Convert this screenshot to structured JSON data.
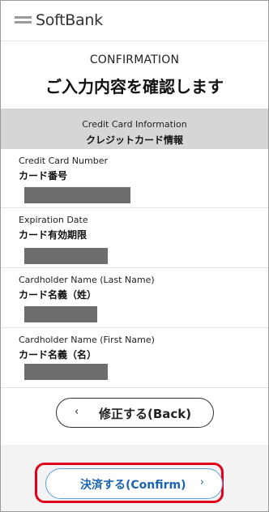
{
  "brand": {
    "name": "SoftBank"
  },
  "header": {
    "title_en": "CONFIRMATION",
    "title_ja": "ご入力内容を確認します"
  },
  "section": {
    "title_en": "Credit Card Information",
    "title_ja": "クレジットカード情報"
  },
  "fields": [
    {
      "label_en": "Credit Card Number",
      "label_ja": "カード番号"
    },
    {
      "label_en": "Expiration Date",
      "label_ja": "カード有効期限"
    },
    {
      "label_en": "Cardholder Name (Last Name)",
      "label_ja": "カード名義（姓）"
    },
    {
      "label_en": "Cardholder Name (First Name)",
      "label_ja": "カード名義（名）"
    }
  ],
  "buttons": {
    "back_label": "修正する(Back)",
    "back_icon": "chevron-left-icon",
    "back_glyph": "‹",
    "confirm_label": "決済する(Confirm)",
    "confirm_icon": "chevron-right-icon",
    "confirm_glyph": "›"
  },
  "colors": {
    "highlight": "#e0001b",
    "confirm_text": "#1b64b0",
    "confirm_border": "#5aa2d8",
    "section_bg": "#d6d6d6",
    "mask": "#6d6d6d"
  }
}
